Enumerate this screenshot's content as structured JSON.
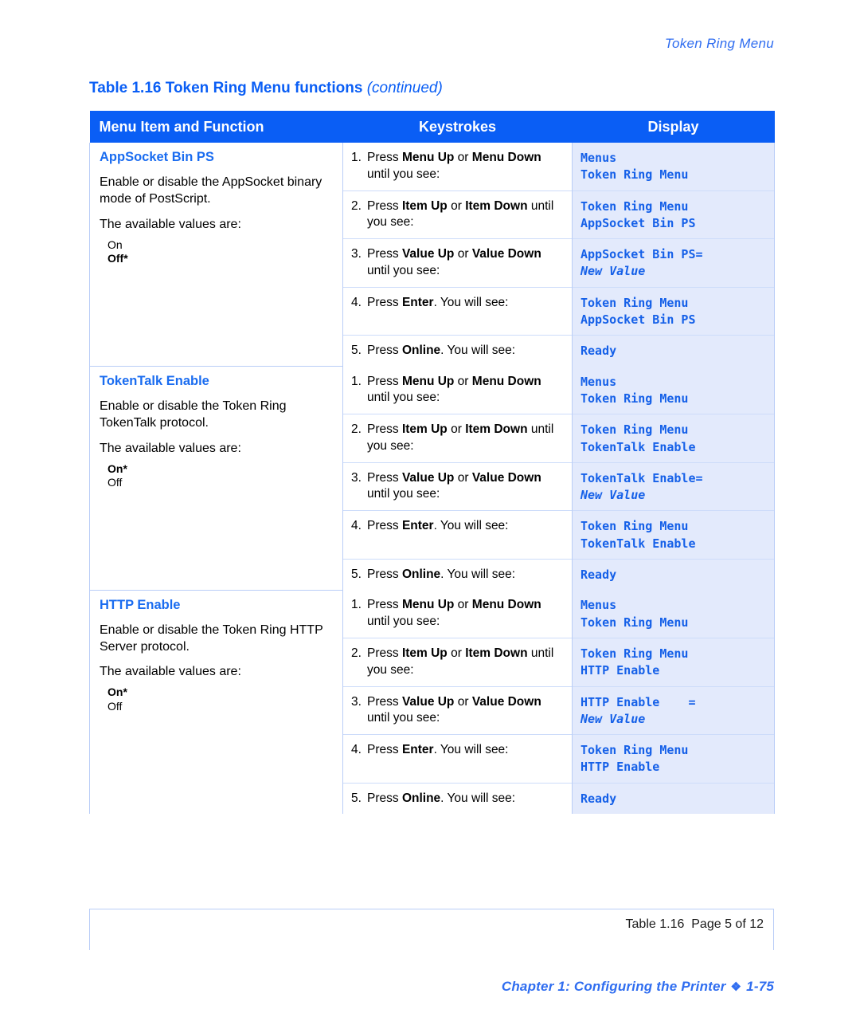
{
  "running_head": "Token Ring Menu",
  "table_caption": {
    "main": "Table 1.16  Token Ring Menu functions ",
    "continued": "(continued)"
  },
  "colors": {
    "header_blue": "#0a5ef5",
    "accent_blue": "#1a6cf0",
    "display_bg": "#e3eafc",
    "border_blue": "#b9cdf7"
  },
  "table_header": {
    "col1": "Menu Item and Function",
    "col2": "Keystrokes",
    "col3": "Display"
  },
  "sections": [
    {
      "title": "AppSocket Bin PS",
      "description": "Enable or disable the AppSocket binary mode of PostScript.",
      "values_lead": "The available values are:",
      "values": [
        {
          "text": "On",
          "bold": false
        },
        {
          "text": "Off*",
          "bold": true
        }
      ],
      "steps": [
        {
          "num": "1.",
          "pre": "Press ",
          "b1": "Menu Up",
          "mid": " or ",
          "b2": "Menu Down",
          "post": " until you see:",
          "display_line1": "Menus",
          "display_line2": "Token Ring Menu",
          "display_line2_italic": false
        },
        {
          "num": "2.",
          "pre": "Press ",
          "b1": "Item Up",
          "mid": " or ",
          "b2": "Item Down",
          "post": " until you see:",
          "display_line1": "Token Ring Menu",
          "display_line2": "AppSocket Bin PS",
          "display_line2_italic": false
        },
        {
          "num": "3.",
          "pre": "Press ",
          "b1": "Value Up",
          "mid": " or ",
          "b2": "Value Down",
          "post": " until you see:",
          "display_line1": "AppSocket Bin PS=",
          "display_line2": "New Value",
          "display_line2_italic": true
        },
        {
          "num": "4.",
          "pre": "Press ",
          "b1": "Enter",
          "mid": "",
          "b2": "",
          "post": ". You will see:",
          "display_line1": "Token Ring Menu",
          "display_line2": "AppSocket Bin PS",
          "display_line2_italic": false
        },
        {
          "num": "5.",
          "pre": "Press ",
          "b1": "Online",
          "mid": "",
          "b2": "",
          "post": ". You will see:",
          "display_line1": "Ready",
          "display_line2": "",
          "display_line2_italic": false
        }
      ]
    },
    {
      "title": "TokenTalk Enable",
      "description": "Enable or disable the Token Ring TokenTalk protocol.",
      "values_lead": "The available values are:",
      "values": [
        {
          "text": "On*",
          "bold": true
        },
        {
          "text": "Off",
          "bold": false
        }
      ],
      "steps": [
        {
          "num": "1.",
          "pre": "Press ",
          "b1": "Menu Up",
          "mid": " or ",
          "b2": "Menu Down",
          "post": " until you see:",
          "display_line1": "Menus",
          "display_line2": "Token Ring Menu",
          "display_line2_italic": false
        },
        {
          "num": "2.",
          "pre": "Press ",
          "b1": "Item Up",
          "mid": " or ",
          "b2": "Item Down",
          "post": " until you see:",
          "display_line1": "Token Ring Menu",
          "display_line2": "TokenTalk Enable",
          "display_line2_italic": false
        },
        {
          "num": "3.",
          "pre": "Press ",
          "b1": "Value Up",
          "mid": " or ",
          "b2": "Value Down",
          "post": " until you see:",
          "display_line1": "TokenTalk Enable=",
          "display_line2": "New Value",
          "display_line2_italic": true
        },
        {
          "num": "4.",
          "pre": "Press ",
          "b1": "Enter",
          "mid": "",
          "b2": "",
          "post": ". You will see:",
          "display_line1": "Token Ring Menu",
          "display_line2": "TokenTalk Enable",
          "display_line2_italic": false
        },
        {
          "num": "5.",
          "pre": "Press ",
          "b1": "Online",
          "mid": "",
          "b2": "",
          "post": ". You will see:",
          "display_line1": "Ready",
          "display_line2": "",
          "display_line2_italic": false
        }
      ]
    },
    {
      "title": "HTTP Enable",
      "description": "Enable or disable the Token Ring HTTP Server protocol.",
      "values_lead": "The available values are:",
      "values": [
        {
          "text": "On*",
          "bold": true
        },
        {
          "text": "Off",
          "bold": false
        }
      ],
      "steps": [
        {
          "num": "1.",
          "pre": "Press ",
          "b1": "Menu Up",
          "mid": " or ",
          "b2": "Menu Down",
          "post": " until you see:",
          "display_line1": "Menus",
          "display_line2": "Token Ring Menu",
          "display_line2_italic": false
        },
        {
          "num": "2.",
          "pre": "Press ",
          "b1": "Item Up",
          "mid": " or ",
          "b2": "Item Down",
          "post": " until you see:",
          "display_line1": "Token Ring Menu",
          "display_line2": "HTTP Enable",
          "display_line2_italic": false
        },
        {
          "num": "3.",
          "pre": "Press ",
          "b1": "Value Up",
          "mid": " or ",
          "b2": "Value Down",
          "post": " until you see:",
          "display_line1": "HTTP Enable    =",
          "display_line2": "New Value",
          "display_line2_italic": true
        },
        {
          "num": "4.",
          "pre": "Press ",
          "b1": "Enter",
          "mid": "",
          "b2": "",
          "post": ". You will see:",
          "display_line1": "Token Ring Menu",
          "display_line2": "HTTP Enable",
          "display_line2_italic": false
        },
        {
          "num": "5.",
          "pre": "Press ",
          "b1": "Online",
          "mid": "",
          "b2": "",
          "post": ". You will see:",
          "display_line1": "Ready",
          "display_line2": "",
          "display_line2_italic": false
        }
      ]
    }
  ],
  "table_footer_text": "Table 1.16  Page 5 of 12",
  "page_footer": {
    "chapter": "Chapter 1: Configuring the Printer",
    "diamond": "❖",
    "page": "1-75"
  }
}
